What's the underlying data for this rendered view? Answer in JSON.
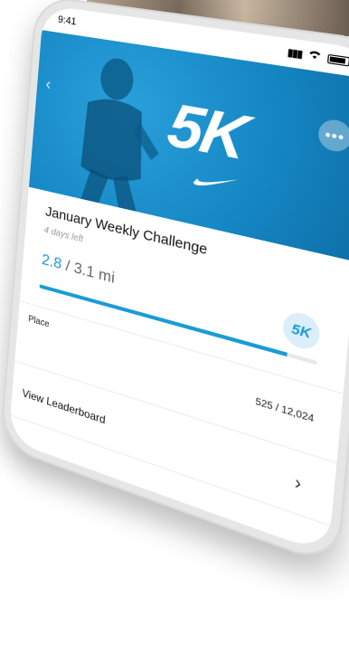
{
  "status_bar": {
    "time": "9:41"
  },
  "hero": {
    "title": "5K",
    "brand_icon": "swoosh-icon"
  },
  "challenge": {
    "title": "January Weekly Challenge",
    "time_left": "4 days left",
    "progress_current": "2.8",
    "progress_total": "/ 3.1 mi",
    "progress_fraction": 0.903,
    "badge": "5K"
  },
  "stats": {
    "place_label": "Place",
    "place_value": "525 / 12,024"
  },
  "leaderboard": {
    "label": "View Leaderboard"
  },
  "colors": {
    "accent": "#1a9bd7",
    "hero_bg": "#1486c3"
  }
}
